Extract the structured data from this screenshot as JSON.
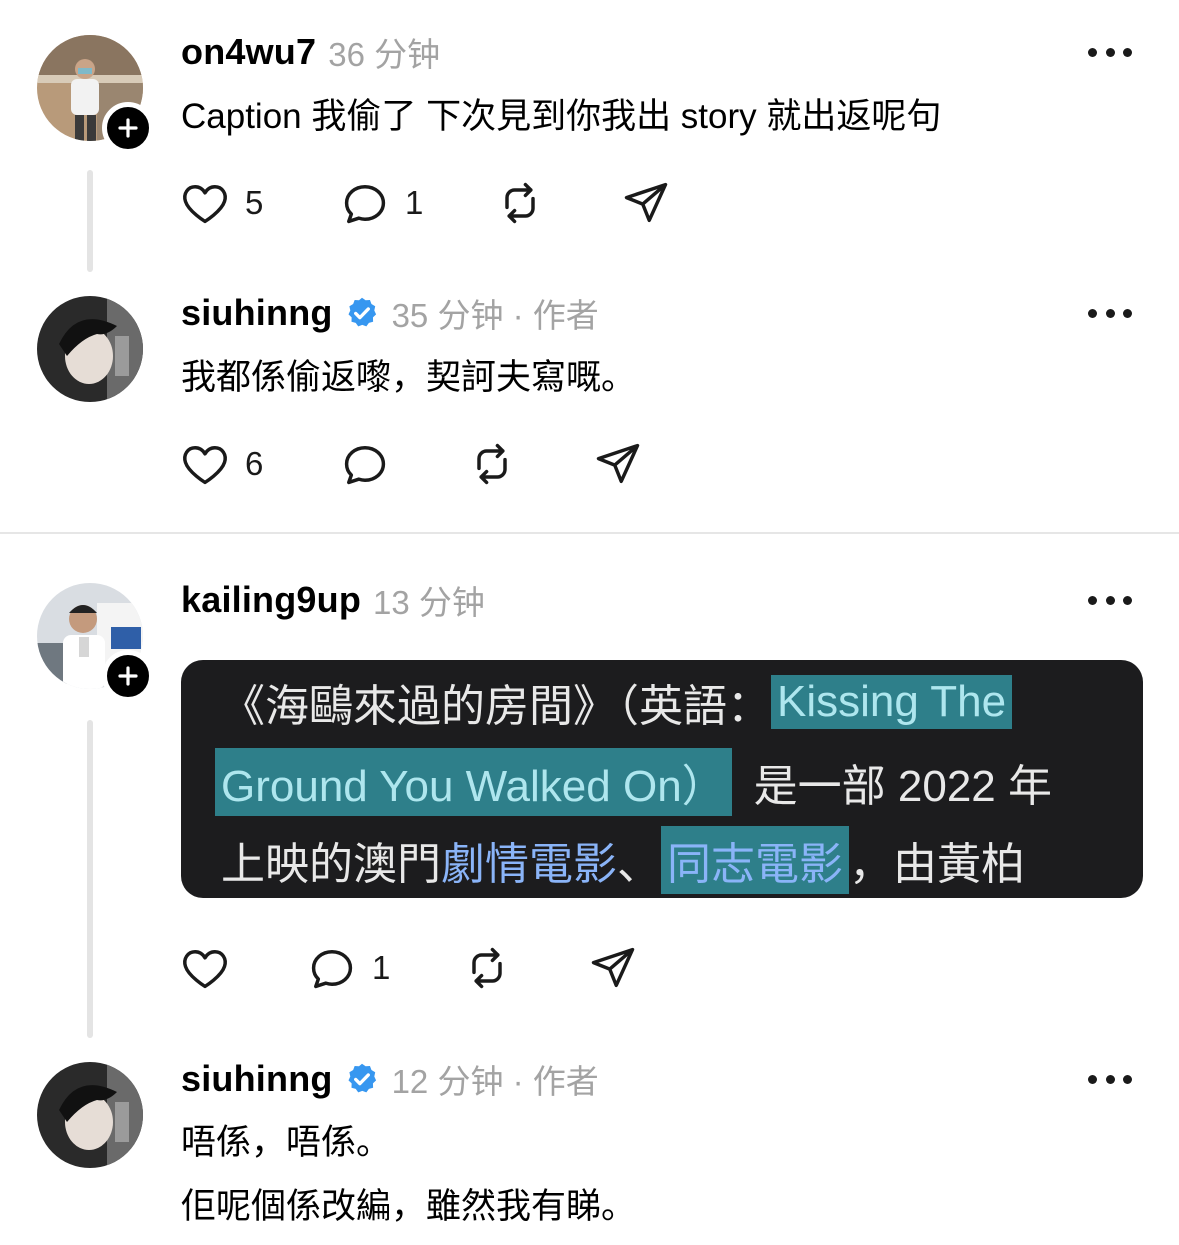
{
  "colors": {
    "meta_gray": "#a3a3a3",
    "verified_blue": "#3797f0",
    "card_bg": "#1c1c1e",
    "card_highlight": "#2e7f8a",
    "card_link": "#8ab4f8"
  },
  "comments": [
    {
      "username": "on4wu7",
      "time": "36 分钟",
      "verified": false,
      "text": "Caption 我偷了 下次見到你我出 story 就出返呢句",
      "likes": "5",
      "replies": "1",
      "icons": [
        "heart-icon",
        "comment-icon",
        "repost-icon",
        "share-icon",
        "more-icon",
        "plus-icon"
      ]
    },
    {
      "username": "siuhinng",
      "time": "35 分钟 · 作者",
      "verified": true,
      "text": "我都係偷返嚟，契訶夫寫嘅。",
      "likes": "6",
      "replies": ""
    },
    {
      "username": "kailing9up",
      "time": "13 分钟",
      "verified": false,
      "likes": "",
      "replies": "1",
      "embedded_card": {
        "line1_prefix": "《海鷗來過的房間》（英語：",
        "line1_highlight": "Kissing The",
        "line2_highlight": "Ground You Walked On）",
        "line2_suffix": "是一部 2022 年",
        "line3_prefix": "上映的澳門",
        "line3_link": "劇情電影",
        "line3_sep": "、",
        "line3_highlight_link": "同志電影",
        "line3_suffix": "，由黃柏"
      }
    },
    {
      "username": "siuhinng",
      "time": "12 分钟 · 作者",
      "verified": true,
      "text_line1": "唔係，唔係。",
      "text_line2": "佢呢個係改編，雖然我有睇。"
    }
  ]
}
